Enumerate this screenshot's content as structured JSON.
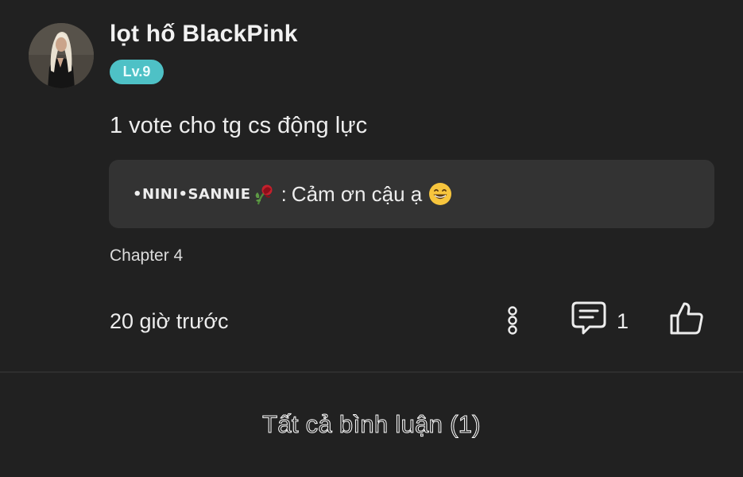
{
  "comment": {
    "user": {
      "name": "lọt hố BlackPink",
      "level": "Lv.9"
    },
    "text": "1 vote cho tg cs động lực",
    "reply_preview": {
      "author": "•NINI•SANNIE",
      "separator": ":",
      "text": "Cảm ơn cậu ạ"
    },
    "chapter": "Chapter 4",
    "timestamp": "20 giờ trước",
    "reply_count": "1"
  },
  "footer": {
    "all_comments_label": "Tất cả bình luận (1)"
  },
  "icons": {
    "more": "more-vertical-icon",
    "reply": "comment-bubble-icon",
    "like": "thumbs-up-icon",
    "rose": "wilted-rose-icon",
    "emoji": "grinning-face-icon"
  },
  "colors": {
    "background": "#212121",
    "card": "#333333",
    "badge": "#4ec1c6",
    "text": "#ededed"
  }
}
